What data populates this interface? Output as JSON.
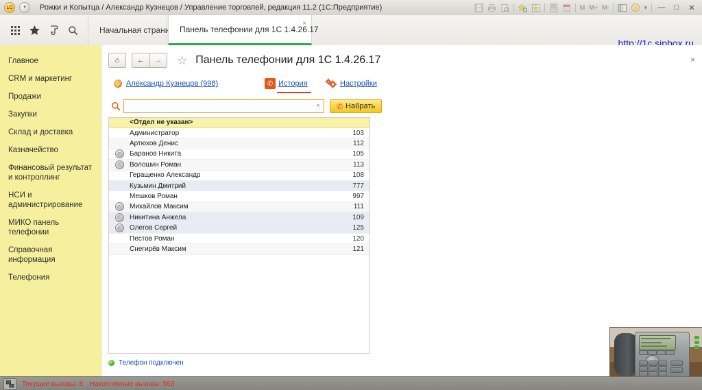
{
  "window": {
    "title": "Рожки и Копытца / Александр Кузнецов / Управление торговлей, редакция 11.2  (1С:Предприятие)",
    "memory_labels": [
      "M",
      "M+",
      "M-"
    ],
    "minimize_label": "—",
    "maximize_label": "□",
    "close_label": "✕",
    "dropdown_label": "▾",
    "icons": [
      "save-icon",
      "print-icon",
      "print-preview-icon",
      "add-favorite-icon",
      "favorites-icon",
      "calculator-icon",
      "calendar-icon",
      "split-window-icon",
      "info-icon"
    ]
  },
  "tabbar": {
    "quick_icons": [
      "menu-grid-icon",
      "favorites-star-icon",
      "history-scroll-icon",
      "search-icon"
    ],
    "tabs": [
      {
        "label": "Начальная страница",
        "active": false
      },
      {
        "label": "Панель телефонии для 1С 1.4.26.17",
        "active": true,
        "close_label": "×"
      }
    ],
    "site_url": "http://1c.sipbox.ru"
  },
  "sidebar": {
    "items": [
      {
        "label": "Главное"
      },
      {
        "label": "CRM и маркетинг"
      },
      {
        "label": "Продажи"
      },
      {
        "label": "Закупки"
      },
      {
        "label": "Склад и доставка"
      },
      {
        "label": "Казначейство"
      },
      {
        "label": "Финансовый результат и контроллинг"
      },
      {
        "label": "НСИ и администрирование"
      },
      {
        "label": "МИКО панель телефонии"
      },
      {
        "label": "Справочная информация"
      },
      {
        "label": "Телефония"
      }
    ]
  },
  "page": {
    "home_label": "⌂",
    "back_label": "←",
    "forward_label": "→",
    "favorite_label": "☆",
    "title": "Панель телефонии для 1С 1.4.26.17",
    "close_label": "×",
    "user_link": "Александр Кузнецов (998)",
    "history_link": "История",
    "settings_link": "Настройки"
  },
  "search": {
    "value": "",
    "placeholder": "",
    "clear_label": "×",
    "dial_button": "Набрать"
  },
  "contacts": {
    "group_header": "<Отдел не указан>",
    "rows": [
      {
        "name": "Администратор",
        "number": "103",
        "has_call_icon": false,
        "style": "plain"
      },
      {
        "name": "Артюхов Денис",
        "number": "112",
        "has_call_icon": false,
        "style": "alt"
      },
      {
        "name": "Баранов Никита",
        "number": "105",
        "has_call_icon": true,
        "style": "plain"
      },
      {
        "name": "Волошин Роман",
        "number": "113",
        "has_call_icon": true,
        "style": "alt"
      },
      {
        "name": "Геращенко Александр",
        "number": "108",
        "has_call_icon": false,
        "style": "plain"
      },
      {
        "name": "Кузьмин Дмитрий",
        "number": "777",
        "has_call_icon": false,
        "style": "sel"
      },
      {
        "name": "Мешков Роман",
        "number": "997",
        "has_call_icon": false,
        "style": "plain"
      },
      {
        "name": "Михайлов Максим",
        "number": "111",
        "has_call_icon": true,
        "style": "alt"
      },
      {
        "name": "Никитина Анжела",
        "number": "109",
        "has_call_icon": true,
        "style": "sel"
      },
      {
        "name": "Олегов Сергей",
        "number": "125",
        "has_call_icon": true,
        "style": "sel"
      },
      {
        "name": "Пестов Роман",
        "number": "120",
        "has_call_icon": false,
        "style": "plain"
      },
      {
        "name": "Снегирёв Максим",
        "number": "121",
        "has_call_icon": false,
        "style": "alt"
      }
    ]
  },
  "status": {
    "phone_status": "Телефон подключен"
  },
  "bottombar": {
    "current_calls": "Текущие вызовы: 8",
    "total_calls": "Накопленные вызовы: 563"
  },
  "colors": {
    "sidebar_bg": "#f5ef9e",
    "accent_yellow": "#f2c81f",
    "accent_orange": "#e2571d",
    "link_blue": "#1a4fc0",
    "tab_active_underline": "#2fa84f",
    "status_red": "#d4352c",
    "status_green": "#3fb61a"
  }
}
